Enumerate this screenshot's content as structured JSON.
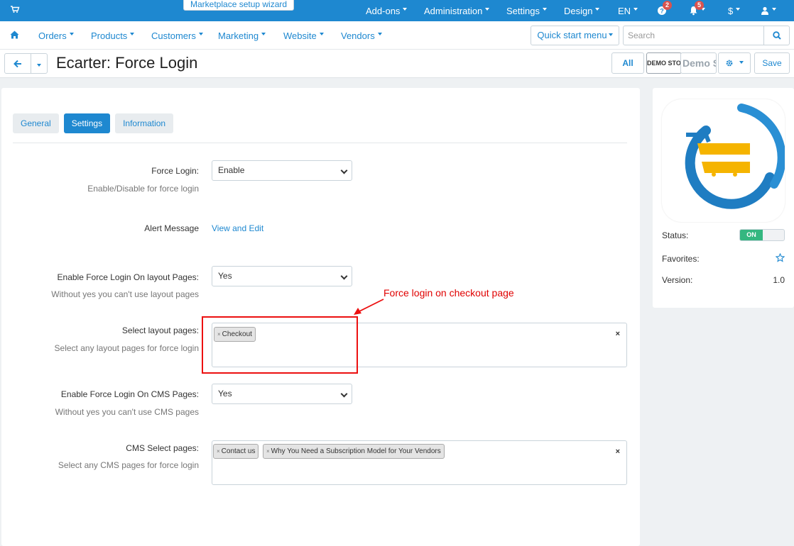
{
  "topbar": {
    "wizard_label": "Marketplace setup wizard",
    "menu": [
      "Add-ons",
      "Administration",
      "Settings",
      "Design",
      "EN"
    ],
    "help_badge": "2",
    "bell_badge": "5",
    "currency": "$"
  },
  "navbar": {
    "menu": [
      "Orders",
      "Products",
      "Customers",
      "Marketing",
      "Website",
      "Vendors"
    ],
    "quick_start": "Quick start menu",
    "search_placeholder": "Search"
  },
  "title_bar": {
    "title": "Ecarter: Force Login",
    "all_label": "All",
    "store_label": "DEMO STORE",
    "store_label_2": "Demo Store",
    "save_label": "Save"
  },
  "tabs": [
    {
      "label": "General",
      "active": false
    },
    {
      "label": "Settings",
      "active": true
    },
    {
      "label": "Information",
      "active": false
    }
  ],
  "settings": {
    "force_login": {
      "label": "Force Login:",
      "value": "Enable",
      "hint": "Enable/Disable for force login"
    },
    "alert_message": {
      "label": "Alert Message",
      "link": "View and Edit"
    },
    "layout_pages_enable": {
      "label": "Enable Force Login On layout Pages:",
      "value": "Yes",
      "hint": "Without yes you can't use layout pages"
    },
    "layout_pages_select": {
      "label": "Select layout pages:",
      "hint": "Select any layout pages for force login",
      "chips": [
        "Checkout"
      ],
      "clear": "×"
    },
    "cms_pages_enable": {
      "label": "Enable Force Login On CMS Pages:",
      "value": "Yes",
      "hint": "Without yes you can't use CMS pages"
    },
    "cms_pages_select": {
      "label": "CMS Select pages:",
      "hint": "Select any CMS pages for force login",
      "chips": [
        "Contact us",
        "Why You Need a Subscription Model for Your Vendors"
      ],
      "clear": "×"
    }
  },
  "annotation": {
    "text": "Force login on checkout page",
    "color": "#e00000"
  },
  "sidebar": {
    "status_label": "Status:",
    "status_value": "ON",
    "favorites_label": "Favorites:",
    "version_label": "Version:",
    "version_value": "1.0"
  },
  "colors": {
    "primary": "#1e88d0",
    "toggle_on": "#34b780",
    "annotation": "#ec1010"
  }
}
